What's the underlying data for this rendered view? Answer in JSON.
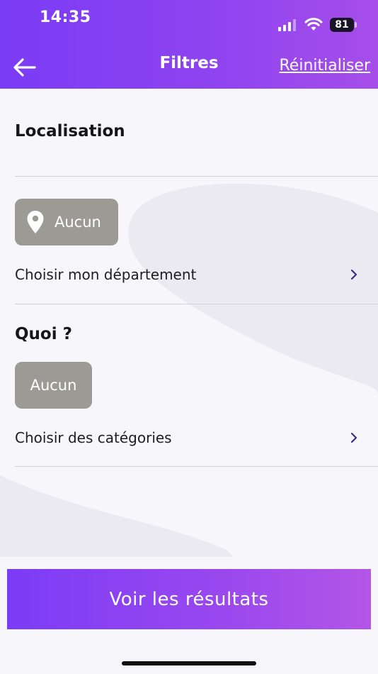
{
  "status_bar": {
    "time": "14:35",
    "battery": "81"
  },
  "header": {
    "title": "Filtres",
    "reset_label": "Réinitialiser"
  },
  "location": {
    "title": "Localisation",
    "chip_label": "Aucun",
    "row_label": "Choisir mon département"
  },
  "what": {
    "title": "Quoi ?",
    "chip_label": "Aucun",
    "row_label": "Choisir des catégories"
  },
  "cta": {
    "label": "Voir les résultats"
  },
  "colors": {
    "accent": "#8a42f2",
    "chip": "#9b9a94",
    "background": "#f7f6fb"
  }
}
